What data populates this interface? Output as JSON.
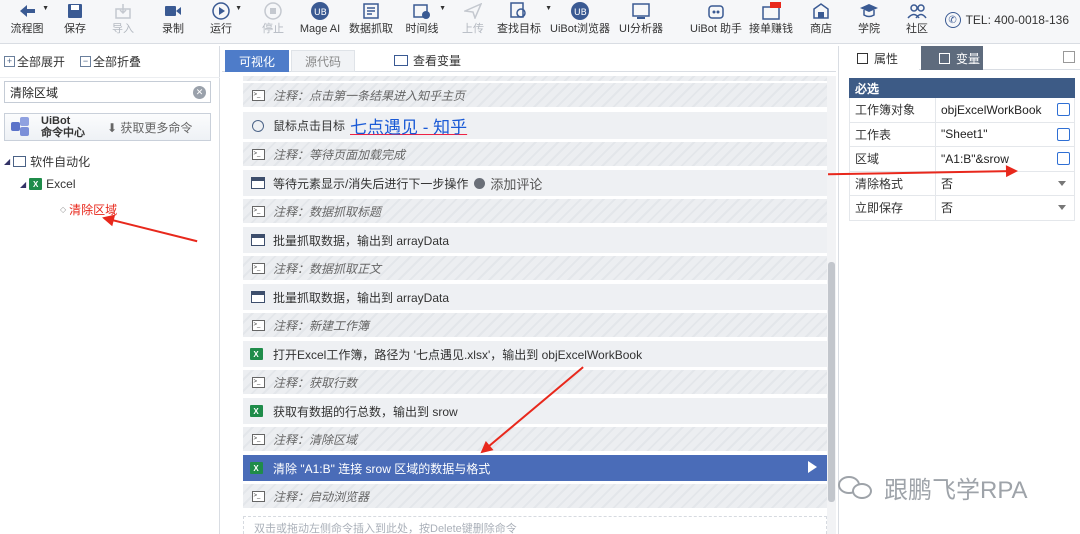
{
  "toolbar": {
    "items": [
      {
        "label": "流程图",
        "icon": "back-arrow-icon",
        "disabled": false
      },
      {
        "label": "保存",
        "icon": "save-icon",
        "disabled": false
      },
      {
        "label": "导入",
        "icon": "import-icon",
        "disabled": true
      },
      {
        "label": "录制",
        "icon": "record-icon",
        "disabled": false
      },
      {
        "label": "运行",
        "icon": "run-icon",
        "disabled": false
      },
      {
        "label": "停止",
        "icon": "stop-icon",
        "disabled": true
      },
      {
        "label": "Mage AI",
        "icon": "mage-ai-icon",
        "disabled": false
      },
      {
        "label": "数据抓取",
        "icon": "data-scrape-icon",
        "disabled": false
      },
      {
        "label": "时间线",
        "icon": "timeline-icon",
        "disabled": false
      },
      {
        "label": "上传",
        "icon": "upload-icon",
        "disabled": true
      },
      {
        "label": "查找目标",
        "icon": "find-target-icon",
        "disabled": false
      },
      {
        "label": "UiBot浏览器",
        "icon": "uibot-browser-icon",
        "disabled": false
      },
      {
        "label": "UI分析器",
        "icon": "ui-analyzer-icon",
        "disabled": false
      },
      {
        "label": "UiBot 助手",
        "icon": "assistant-icon",
        "disabled": false
      },
      {
        "label": "接单赚钱",
        "icon": "earn-icon",
        "disabled": false
      },
      {
        "label": "商店",
        "icon": "store-icon",
        "disabled": false
      },
      {
        "label": "学院",
        "icon": "academy-icon",
        "disabled": false
      },
      {
        "label": "社区",
        "icon": "community-icon",
        "disabled": false
      }
    ],
    "tel": "TEL: 400-0018-136"
  },
  "left": {
    "expand_all": "全部展开",
    "collapse_all": "全部折叠",
    "search_value": "清除区域",
    "cmd_center_line1": "UiBot",
    "cmd_center_line2": "命令中心",
    "get_more": "获取更多命令",
    "tree": {
      "root": "软件自动化",
      "child": "Excel",
      "leaf": "清除区域"
    }
  },
  "middle": {
    "tab_visual": "可视化",
    "tab_source": "源代码",
    "view_vars": "查看变量",
    "rows": [
      {
        "type": "comment",
        "text": "注释：点击第一条结果进入知乎主页"
      },
      {
        "type": "cmd",
        "icon": "mouse",
        "text": "鼠标点击目标",
        "link": "七点遇见 - 知乎"
      },
      {
        "type": "comment",
        "text": "注释：等待页面加载完成"
      },
      {
        "type": "cmd",
        "icon": "window",
        "text": "等待元素显示/消失后进行下一步操作",
        "extra": "添加评论"
      },
      {
        "type": "comment",
        "text": "注释：数据抓取标题"
      },
      {
        "type": "cmd",
        "icon": "window",
        "text": "批量抓取数据，输出到 arrayData"
      },
      {
        "type": "comment",
        "text": "注释：数据抓取正文"
      },
      {
        "type": "cmd",
        "icon": "window",
        "text": "批量抓取数据，输出到 arrayData"
      },
      {
        "type": "comment",
        "text": "注释：新建工作簿"
      },
      {
        "type": "cmd",
        "icon": "excel",
        "text": "打开Excel工作簿，路径为 '七点遇见.xlsx'，输出到 objExcelWorkBook"
      },
      {
        "type": "comment",
        "text": "注释：获取行数"
      },
      {
        "type": "cmd",
        "icon": "excel",
        "text": "获取有数据的行总数，输出到 srow"
      },
      {
        "type": "comment",
        "text": "注释：清除区域"
      },
      {
        "type": "selected",
        "icon": "excel",
        "text": "清除 \"A1:B\" 连接 srow 区域的数据与格式"
      },
      {
        "type": "comment",
        "text": "注释：启动浏览器"
      }
    ],
    "hint": "双击或拖动左侧命令插入到此处，按Delete键删除命令"
  },
  "right": {
    "tab_props": "属性",
    "tab_vars": "变量",
    "section": "必选",
    "props": [
      {
        "key": "工作簿对象",
        "value": "objExcelWorkBook",
        "control": "edit"
      },
      {
        "key": "工作表",
        "value": "\"Sheet1\"",
        "control": "edit"
      },
      {
        "key": "区域",
        "value": "\"A1:B\"&srow",
        "control": "edit"
      },
      {
        "key": "清除格式",
        "value": "否",
        "control": "dropdown"
      },
      {
        "key": "立即保存",
        "value": "否",
        "control": "dropdown"
      }
    ]
  },
  "watermark": "跟鹏飞学RPA",
  "colors": {
    "accent": "#4e7cc9",
    "selected_row": "#4a6cb8",
    "section": "#3d5b86",
    "annotation": "#e8281c",
    "excel": "#1f8c4a"
  }
}
